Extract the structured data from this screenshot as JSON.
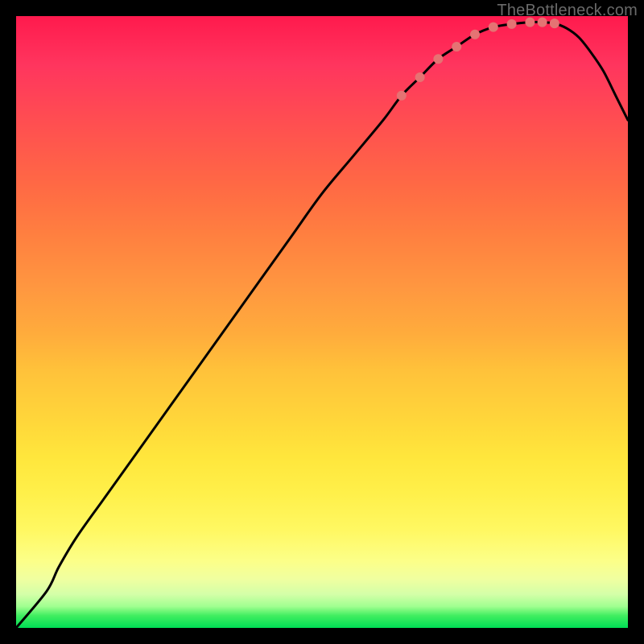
{
  "watermark": "TheBottleneck.com",
  "chart_data": {
    "type": "line",
    "title": "",
    "xlabel": "",
    "ylabel": "",
    "xlim": [
      0,
      100
    ],
    "ylim": [
      0,
      100
    ],
    "x": [
      0,
      5,
      7,
      10,
      15,
      20,
      25,
      30,
      35,
      40,
      45,
      50,
      55,
      60,
      63,
      66,
      69,
      72,
      75,
      78,
      81,
      84,
      86,
      88,
      90,
      92,
      94,
      96,
      98,
      100
    ],
    "values": [
      0,
      6,
      10,
      15,
      22,
      29,
      36,
      43,
      50,
      57,
      64,
      71,
      77,
      83,
      87,
      90,
      93,
      95,
      97,
      98.2,
      98.7,
      99,
      99,
      98.8,
      98,
      96.5,
      94,
      91,
      87,
      83
    ],
    "valley_markers_x": [
      63,
      66,
      69,
      72,
      75,
      78,
      81,
      84,
      86,
      88
    ],
    "valley_markers_y": [
      87,
      90,
      93,
      95,
      97,
      98.2,
      98.7,
      99,
      99,
      98.8
    ],
    "marker_color": "#e57373",
    "line_color": "#000000",
    "background": {
      "type": "vertical-gradient",
      "stops": [
        {
          "pos": 0,
          "color": "#ff1a4d"
        },
        {
          "pos": 50,
          "color": "#ffb03a"
        },
        {
          "pos": 85,
          "color": "#fff862"
        },
        {
          "pos": 100,
          "color": "#00dd55"
        }
      ]
    }
  }
}
